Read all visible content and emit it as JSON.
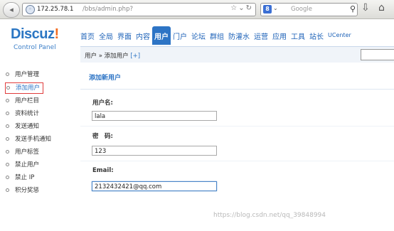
{
  "browser": {
    "url_host": "172.25.78.1",
    "url_path": "/bbs/admin.php?",
    "search_placeholder": "Google",
    "search_engine_letter": "8"
  },
  "header": {
    "logo_main": "Discuz",
    "logo_bang": "!",
    "logo_sub": "Control Panel",
    "nav": [
      {
        "label": "首页"
      },
      {
        "label": "全局"
      },
      {
        "label": "界面"
      },
      {
        "label": "内容"
      },
      {
        "label": "用户"
      },
      {
        "label": "门户"
      },
      {
        "label": "论坛"
      },
      {
        "label": "群组"
      },
      {
        "label": "防灌水"
      },
      {
        "label": "运营"
      },
      {
        "label": "应用"
      },
      {
        "label": "工具"
      },
      {
        "label": "站长"
      },
      {
        "label": "UCenter"
      }
    ],
    "active_nav": "用户"
  },
  "breadcrumb": {
    "text": "用户 » 添加用户",
    "plus": "[+]"
  },
  "sidebar": {
    "items": [
      {
        "label": "用户管理"
      },
      {
        "label": "添加用户"
      },
      {
        "label": "用户栏目"
      },
      {
        "label": "资料统计"
      },
      {
        "label": "发送通知"
      },
      {
        "label": "发送手机通知"
      },
      {
        "label": "用户标签"
      },
      {
        "label": "禁止用户"
      },
      {
        "label": "禁止 IP"
      },
      {
        "label": "积分奖惩"
      }
    ],
    "active": "添加用户"
  },
  "form": {
    "title": "添加新用户",
    "username_label": "用户名:",
    "username_value": "lala",
    "password_label": "密　码:",
    "password_value": "123",
    "email_label": "Email:",
    "email_value": "2132432421@qq.com"
  },
  "watermark": "https://blog.csdn.net/qq_39848994"
}
